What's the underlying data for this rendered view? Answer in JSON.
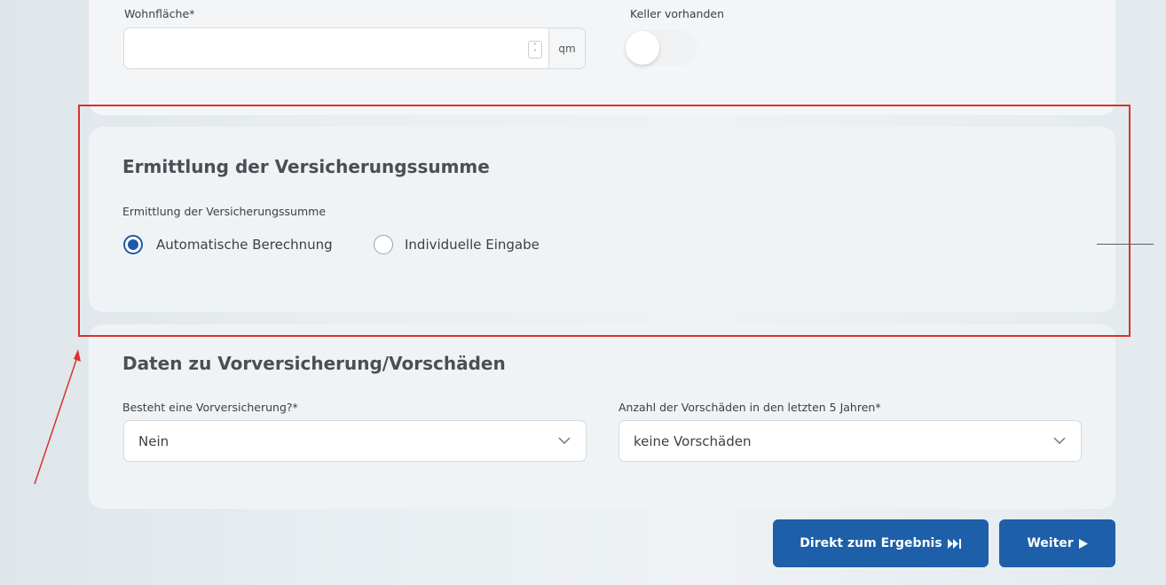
{
  "top": {
    "area_label": "Wohnfläche*",
    "area_value": "",
    "area_unit": "qm",
    "basement_label": "Keller vorhanden"
  },
  "insurance_sum": {
    "title": "Ermittlung der Versicherungssumme",
    "field_label": "Ermittlung der Versicherungssumme",
    "options": [
      {
        "label": "Automatische Berechnung",
        "checked": true
      },
      {
        "label": "Individuelle Eingabe",
        "checked": false
      }
    ]
  },
  "previous": {
    "title": "Daten zu Vorversicherung/Vorschäden",
    "prior_insurance_label": "Besteht eine Vorversicherung?*",
    "prior_insurance_value": "Nein",
    "claims_label": "Anzahl der Vorschäden in den letzten 5 Jahren*",
    "claims_value": "keine Vorschäden"
  },
  "buttons": {
    "direct_result": "Direkt zum Ergebnis",
    "next": "Weiter"
  },
  "colors": {
    "primary": "#1d5fa8",
    "annotation": "#d9322e"
  }
}
